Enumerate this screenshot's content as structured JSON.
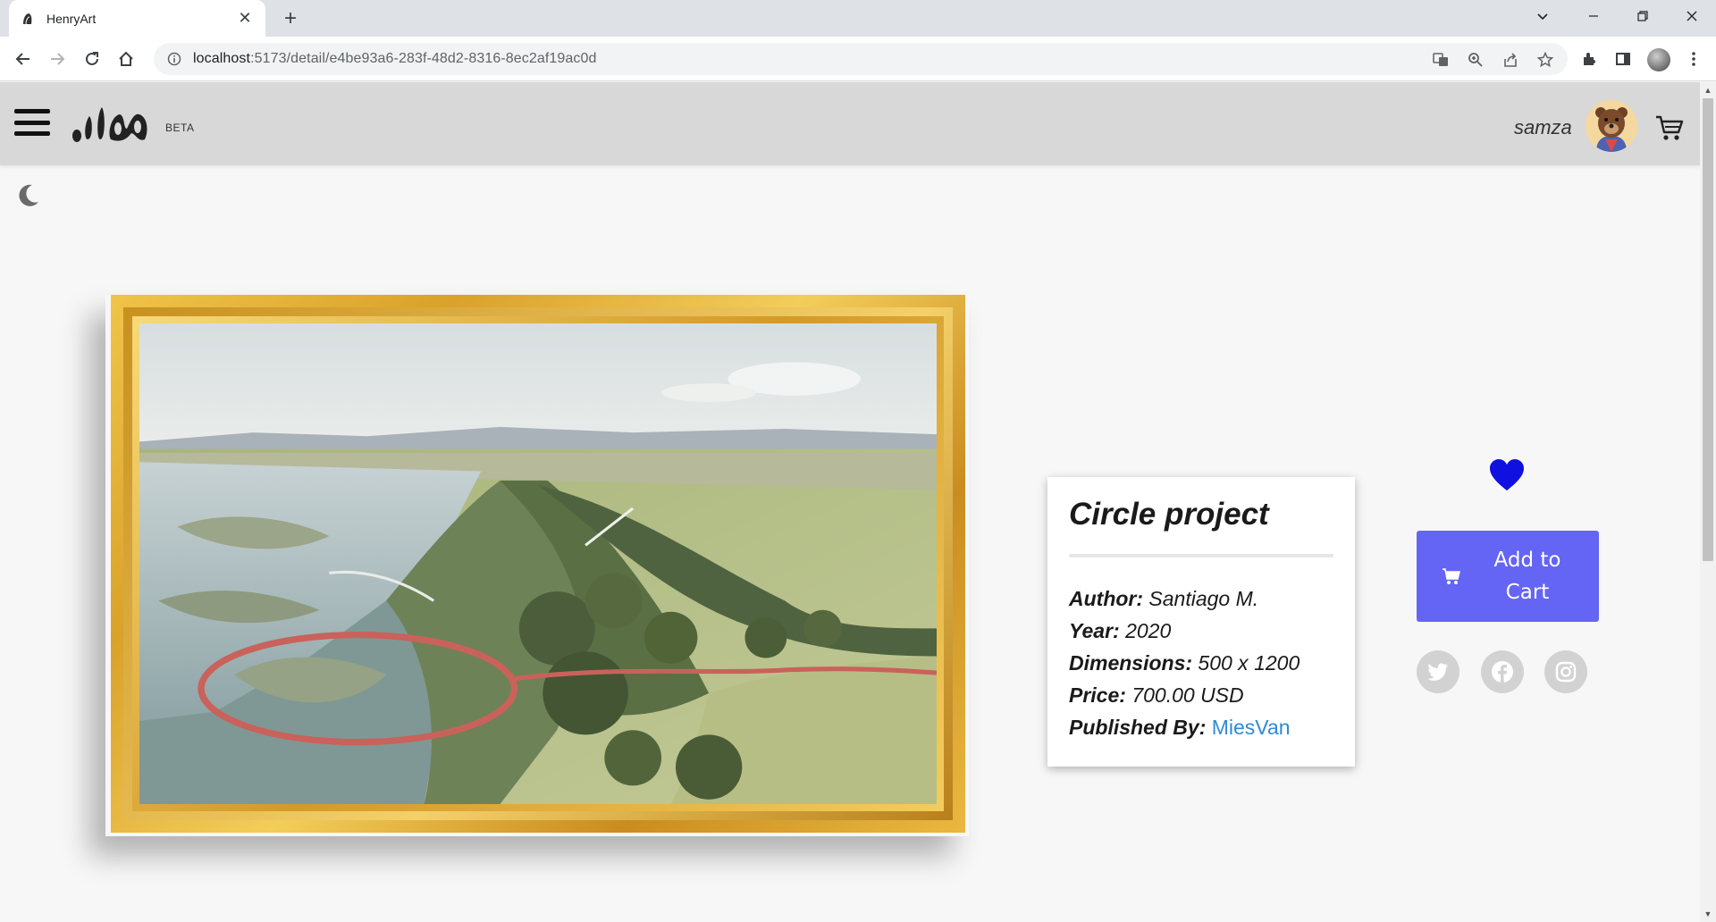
{
  "browser": {
    "tab_title": "HenryArt",
    "url_host": "localhost",
    "url_path": ":5173/detail/e4be93a6-283f-48d2-8316-8ec2af19ac0d"
  },
  "header": {
    "beta_label": "BETA",
    "username": "samza"
  },
  "artwork": {
    "title": "Circle project",
    "author_label": "Author:",
    "author": "Santiago M.",
    "year_label": "Year:",
    "year": "2020",
    "dimensions_label": "Dimensions:",
    "dimensions": "500 x 1200",
    "price_label": "Price:",
    "price": "700.00 USD",
    "published_label": "Published By:",
    "published_by": "MiesVan"
  },
  "actions": {
    "add_to_cart_line1": "Add to",
    "add_to_cart_line2": "Cart",
    "favorite_color": "#1010e0",
    "button_color": "#6464f5"
  },
  "icons": [
    "menu-icon",
    "moon-icon",
    "heart-icon",
    "cart-icon",
    "twitter-icon",
    "facebook-icon",
    "instagram-icon"
  ]
}
